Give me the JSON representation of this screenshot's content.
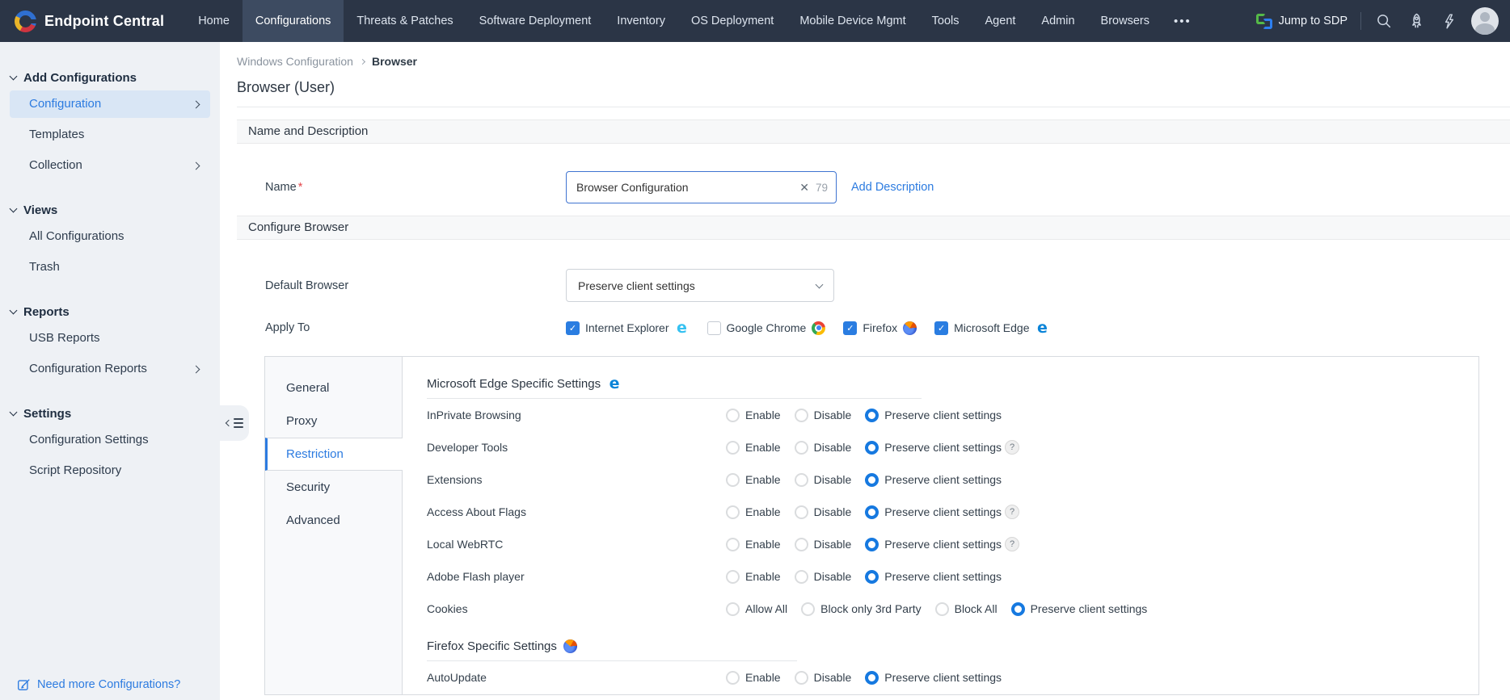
{
  "nav": {
    "brand": "Endpoint Central",
    "items": [
      "Home",
      "Configurations",
      "Threats & Patches",
      "Software Deployment",
      "Inventory",
      "OS Deployment",
      "Mobile Device Mgmt",
      "Tools",
      "Agent",
      "Admin",
      "Browsers"
    ],
    "active_item": "Configurations",
    "more_label": "•••",
    "jump_to_sdp_label": "Jump to SDP",
    "icons": [
      "sdp-icon",
      "search-icon",
      "rocket-icon",
      "bolt-icon",
      "avatar"
    ]
  },
  "sidebar": {
    "sections": [
      {
        "label": "Add Configurations",
        "items": [
          {
            "label": "Configuration",
            "active": true,
            "chevron": true
          },
          {
            "label": "Templates",
            "active": false,
            "chevron": false
          },
          {
            "label": "Collection",
            "active": false,
            "chevron": true
          }
        ]
      },
      {
        "label": "Views",
        "items": [
          {
            "label": "All Configurations",
            "active": false,
            "chevron": false
          },
          {
            "label": "Trash",
            "active": false,
            "chevron": false
          }
        ]
      },
      {
        "label": "Reports",
        "items": [
          {
            "label": "USB Reports",
            "active": false,
            "chevron": false
          },
          {
            "label": "Configuration Reports",
            "active": false,
            "chevron": true
          }
        ]
      },
      {
        "label": "Settings",
        "items": [
          {
            "label": "Configuration Settings",
            "active": false,
            "chevron": false
          },
          {
            "label": "Script Repository",
            "active": false,
            "chevron": false
          }
        ]
      }
    ],
    "footer_link": "Need more Configurations?"
  },
  "breadcrumb": {
    "parent": "Windows Configuration",
    "current": "Browser"
  },
  "page": {
    "title": "Browser (User)"
  },
  "name_section": {
    "header": "Name and Description",
    "name_label": "Name",
    "required_mark": "*",
    "name_value": "Browser Configuration",
    "clear_icon": "✕",
    "char_count": "79",
    "add_description_label": "Add Description"
  },
  "configure_section": {
    "header": "Configure Browser",
    "default_browser_label": "Default Browser",
    "default_browser_value": "Preserve client settings",
    "apply_to_label": "Apply To",
    "browsers": [
      {
        "label": "Internet Explorer",
        "checked": true,
        "icon": "ie-icon"
      },
      {
        "label": "Google Chrome",
        "checked": false,
        "icon": "chrome-icon"
      },
      {
        "label": "Firefox",
        "checked": true,
        "icon": "firefox-icon"
      },
      {
        "label": "Microsoft Edge",
        "checked": true,
        "icon": "edge-icon"
      }
    ]
  },
  "tabs": {
    "items": [
      "General",
      "Proxy",
      "Restriction",
      "Security",
      "Advanced"
    ],
    "active": "Restriction"
  },
  "settings_panel": {
    "groups": [
      {
        "heading": "Microsoft Edge Specific Settings",
        "icon": "edge-icon",
        "rows": [
          {
            "label": "InPrivate Browsing",
            "options": [
              "Enable",
              "Disable",
              "Preserve client settings"
            ],
            "selected": "Preserve client settings",
            "help": false
          },
          {
            "label": "Developer Tools",
            "options": [
              "Enable",
              "Disable",
              "Preserve client settings"
            ],
            "selected": "Preserve client settings",
            "help": true
          },
          {
            "label": "Extensions",
            "options": [
              "Enable",
              "Disable",
              "Preserve client settings"
            ],
            "selected": "Preserve client settings",
            "help": false
          },
          {
            "label": "Access About Flags",
            "options": [
              "Enable",
              "Disable",
              "Preserve client settings"
            ],
            "selected": "Preserve client settings",
            "help": true
          },
          {
            "label": "Local WebRTC",
            "options": [
              "Enable",
              "Disable",
              "Preserve client settings"
            ],
            "selected": "Preserve client settings",
            "help": true
          },
          {
            "label": "Adobe Flash player",
            "options": [
              "Enable",
              "Disable",
              "Preserve client settings"
            ],
            "selected": "Preserve client settings",
            "help": false
          },
          {
            "label": "Cookies",
            "options": [
              "Allow All",
              "Block only 3rd Party",
              "Block All",
              "Preserve client settings"
            ],
            "selected": "Preserve client settings",
            "help": false
          }
        ]
      },
      {
        "heading": "Firefox Specific Settings",
        "icon": "firefox-icon",
        "rows": [
          {
            "label": "AutoUpdate",
            "options": [
              "Enable",
              "Disable",
              "Preserve client settings"
            ],
            "selected": "Preserve client settings",
            "help": false
          }
        ]
      }
    ]
  },
  "colors": {
    "nav_bg": "#2b3546",
    "nav_active_bg": "#3d4b61",
    "accent": "#2c7be0",
    "sidebar_bg": "#eef1f5",
    "active_item_bg": "#d9e6f5",
    "radio_selected": "#1679e0",
    "checkbox_checked": "#2a7de1",
    "required": "#e5484d",
    "input_border_focus": "#3f74d1"
  }
}
